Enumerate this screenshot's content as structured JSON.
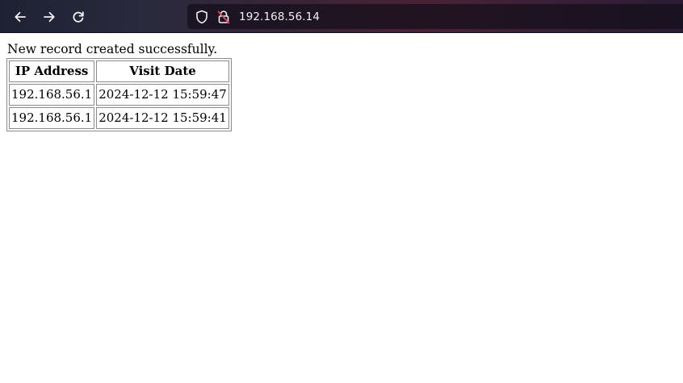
{
  "browser": {
    "url": "192.168.56.14",
    "icons": {
      "back": "arrow-left-icon",
      "forward": "arrow-right-icon",
      "reload": "reload-icon",
      "tracking_protection": "shield-icon",
      "connection": "insecure-lock-icon"
    },
    "colors": {
      "toolbar_start": "#1d2233",
      "toolbar_mid": "#4a2236",
      "insecure_lock": "#e0475a"
    }
  },
  "page": {
    "message": "New record created successfully.",
    "table": {
      "headers": [
        "IP Address",
        "Visit Date"
      ],
      "rows": [
        [
          "192.168.56.1",
          "2024-12-12 15:59:47"
        ],
        [
          "192.168.56.1",
          "2024-12-12 15:59:41"
        ]
      ]
    }
  }
}
